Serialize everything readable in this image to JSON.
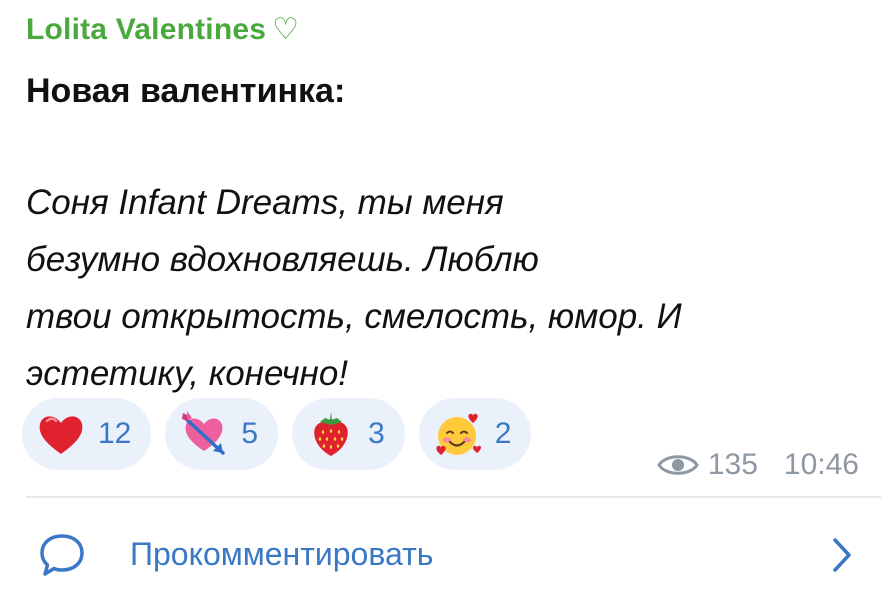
{
  "post": {
    "channel_name": "Lolita Valentines",
    "channel_heart": "♡",
    "title": "Новая валентинка:",
    "body": "Соня Infant Dreams, ты меня\nбезумно вдохновляешь. Люблю\nтвои открытость, смелость, юмор. И\nэстетику, конечно!"
  },
  "reactions": [
    {
      "emoji": "red-heart",
      "count": "12"
    },
    {
      "emoji": "heart-with-arrow",
      "count": "5"
    },
    {
      "emoji": "strawberry",
      "count": "3"
    },
    {
      "emoji": "smiling-face-with-hearts",
      "count": "2"
    }
  ],
  "meta": {
    "views": "135",
    "time": "10:46"
  },
  "comment": {
    "label": "Прокомментировать"
  },
  "colors": {
    "channel_name": "#4aa83e",
    "accent": "#3a78c5",
    "reaction_bg": "#eaf1fb",
    "meta": "#8d98a3"
  }
}
